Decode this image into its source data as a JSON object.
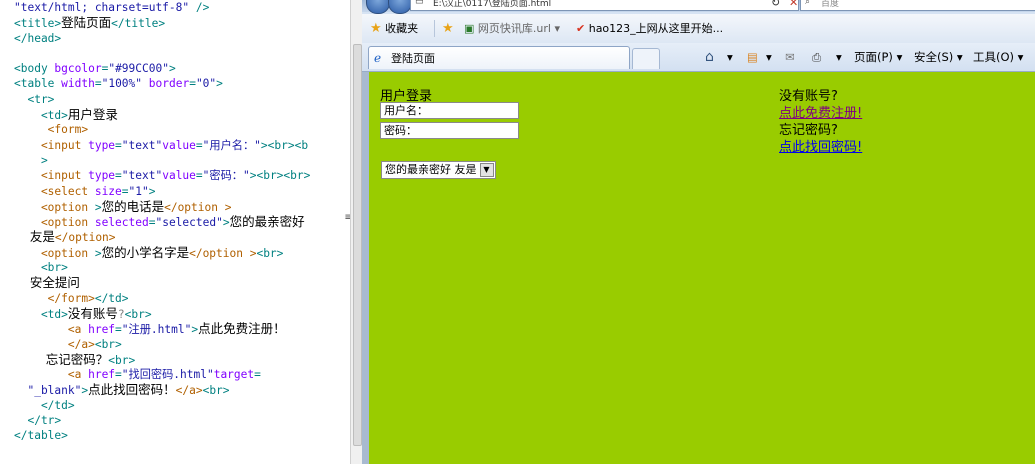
{
  "editor": {
    "lines": [
      [
        [
          "c-str",
          "\"text/html; charset=utf-8\""
        ],
        [
          "c-tag",
          " />"
        ]
      ],
      [
        [
          "c-tag",
          "<title>"
        ],
        [
          "c-txt",
          "登陆页面"
        ],
        [
          "c-tag",
          "</title>"
        ]
      ],
      [
        [
          "c-tag",
          "</head>"
        ]
      ],
      [
        [
          "c-tag",
          ""
        ]
      ],
      [
        [
          "c-tag",
          "<body "
        ],
        [
          "c-attr",
          "bgcolor"
        ],
        [
          "c-tag",
          "="
        ],
        [
          "c-str",
          "\"#99CC00\""
        ],
        [
          "c-tag",
          ">"
        ]
      ],
      [
        [
          "c-tag",
          "<table "
        ],
        [
          "c-attr",
          "width"
        ],
        [
          "c-tag",
          "="
        ],
        [
          "c-str",
          "\"100%\""
        ],
        [
          "c-tag",
          " "
        ],
        [
          "c-attr",
          "border"
        ],
        [
          "c-tag",
          "="
        ],
        [
          "c-str",
          "\"0\""
        ],
        [
          "c-tag",
          ">"
        ]
      ],
      [
        [
          "c-tag",
          "  <tr>"
        ]
      ],
      [
        [
          "c-tag",
          "    <td>"
        ],
        [
          "c-txt",
          "用户登录"
        ]
      ],
      [
        [
          "c-brown",
          "     <form>"
        ]
      ],
      [
        [
          "c-brown",
          "    <input "
        ],
        [
          "c-attr",
          "type"
        ],
        [
          "c-tag",
          "="
        ],
        [
          "c-str",
          "\"text\""
        ],
        [
          "c-attr",
          "value"
        ],
        [
          "c-tag",
          "="
        ],
        [
          "c-str",
          "\"用户名："
        ],
        [
          "c-str",
          "\""
        ],
        [
          "c-tag",
          ">"
        ],
        [
          "c-tag",
          "<br><b"
        ]
      ],
      [
        [
          "c-tag",
          "    >"
        ]
      ],
      [
        [
          "c-brown",
          "    <input "
        ],
        [
          "c-attr",
          "type"
        ],
        [
          "c-tag",
          "="
        ],
        [
          "c-str",
          "\"text\""
        ],
        [
          "c-attr",
          "value"
        ],
        [
          "c-tag",
          "="
        ],
        [
          "c-str",
          "\"密码："
        ],
        [
          "c-str",
          "\""
        ],
        [
          "c-tag",
          ">"
        ],
        [
          "c-tag",
          "<br><br>"
        ]
      ],
      [
        [
          "c-brown",
          "    <select "
        ],
        [
          "c-attr",
          "size"
        ],
        [
          "c-tag",
          "="
        ],
        [
          "c-str",
          "\"1\""
        ],
        [
          "c-tag",
          ">"
        ]
      ],
      [
        [
          "c-brown",
          "    <option "
        ],
        [
          "c-tag",
          ">"
        ],
        [
          "c-txt",
          "您的电话是"
        ],
        [
          "c-brown",
          "</option >"
        ]
      ],
      [
        [
          "c-brown",
          "    <option "
        ],
        [
          "c-attr",
          "selected"
        ],
        [
          "c-tag",
          "="
        ],
        [
          "c-str",
          "\"selected\""
        ],
        [
          "c-tag",
          ">"
        ],
        [
          "c-txt",
          "您的最亲密好"
        ]
      ],
      [
        [
          "c-txt",
          "    友是"
        ],
        [
          "c-brown",
          "</option>"
        ]
      ],
      [
        [
          "c-brown",
          "    <option "
        ],
        [
          "c-tag",
          ">"
        ],
        [
          "c-txt",
          "您的小学名字是"
        ],
        [
          "c-brown",
          "</option >"
        ],
        [
          "c-tag",
          "<br>"
        ]
      ],
      [
        [
          "c-tag",
          "    <br>"
        ]
      ],
      [
        [
          "c-txt",
          "    安全提问"
        ]
      ],
      [
        [
          "c-brown",
          "     </form>"
        ],
        [
          "c-tag",
          "</td>"
        ]
      ],
      [
        [
          "c-tag",
          "    <td>"
        ],
        [
          "c-txt",
          "没有账号"
        ],
        [
          "c-gray",
          "?"
        ],
        [
          "c-tag",
          "<br>"
        ]
      ],
      [
        [
          "c-brown",
          "        <a "
        ],
        [
          "c-attr",
          "href"
        ],
        [
          "c-tag",
          "="
        ],
        [
          "c-str",
          "\"注册.html\""
        ],
        [
          "c-tag",
          ">"
        ],
        [
          "c-txt",
          "点此免费注册！"
        ]
      ],
      [
        [
          "c-brown",
          "        </a>"
        ],
        [
          "c-tag",
          "<br>"
        ]
      ],
      [
        [
          "c-txt",
          "        忘记密码？"
        ],
        [
          "c-tag",
          "<br>"
        ]
      ],
      [
        [
          "c-brown",
          "        <a "
        ],
        [
          "c-attr",
          "href"
        ],
        [
          "c-tag",
          "="
        ],
        [
          "c-str",
          "\"找回密码.html\""
        ],
        [
          "c-attr",
          "target"
        ],
        [
          "c-tag",
          "="
        ]
      ],
      [
        [
          "c-str",
          "  \"_blank\""
        ],
        [
          "c-tag",
          ">"
        ],
        [
          "c-txt",
          "点此找回密码！"
        ],
        [
          "c-brown",
          "</a>"
        ],
        [
          "c-tag",
          "<br>"
        ]
      ],
      [
        [
          "c-tag",
          "    </td>"
        ]
      ],
      [
        [
          "c-tag",
          "  </tr>"
        ]
      ],
      [
        [
          "c-tag",
          "</table>"
        ]
      ]
    ],
    "split_marker": "≡"
  },
  "browser": {
    "address_text": "E:\\汉正\\0117\\登陆页面.html",
    "search_placeholder": "百度",
    "favorites_label": "收藏夹",
    "fav_links": [
      "网页快讯库.url ▾",
      "hao123_上网从这里开始..."
    ],
    "tab_title": "登陆页面",
    "toolbar": {
      "page": "页面(P) ▾",
      "safety": "安全(S) ▾",
      "tools": "工具(O) ▾",
      "home_arrow": "▾",
      "feeds_arrow": "▾",
      "print_arrow": "▾"
    }
  },
  "page": {
    "login_title": "用户登录",
    "username_value": "用户名：",
    "password_value": "密码：",
    "select_selected": "您的最亲密好 友是",
    "no_account": "没有账号?",
    "register_link": "点此免费注册!",
    "forgot": "忘记密码?",
    "recover_link": "点此找回密码!"
  },
  "colors": {
    "page_bg": "#99cc00",
    "register_link": "#800080",
    "recover_link": "#0000ee"
  }
}
